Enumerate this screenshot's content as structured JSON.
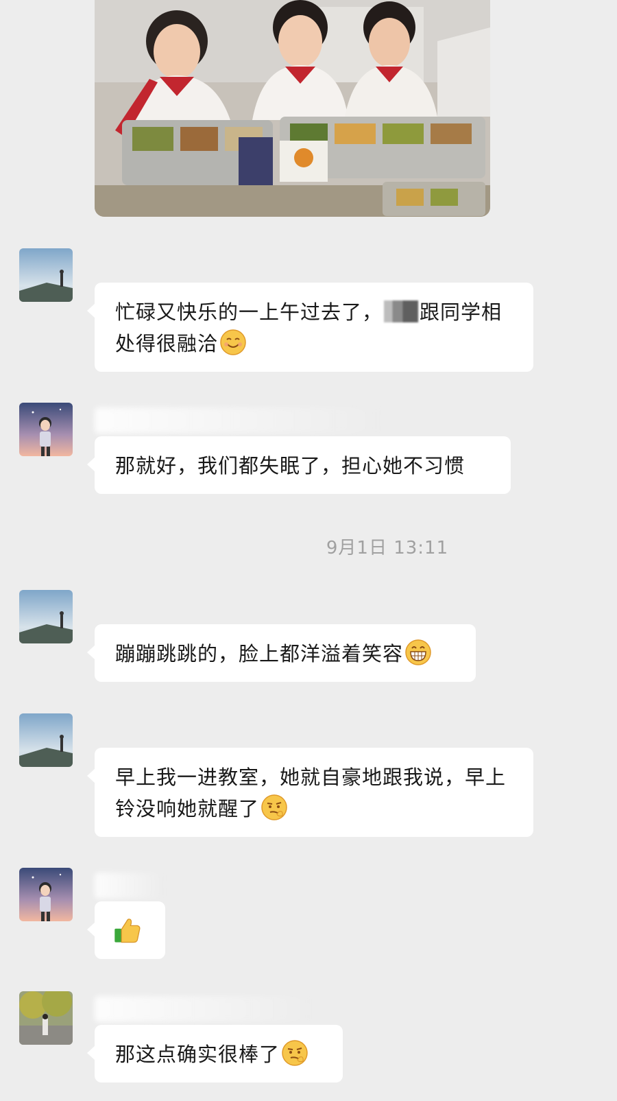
{
  "messages": [
    {
      "id": "m1",
      "text_a": "忙碌又快乐的一上午过去了，",
      "text_b": "跟同学相处得很融洽",
      "emoji": "smile-emoji-icon"
    },
    {
      "id": "m2",
      "text": "那就好，我们都失眠了，担心她不习惯"
    },
    {
      "id": "m3",
      "text": "蹦蹦跳跳的，脸上都洋溢着笑容",
      "emoji": "grin-emoji-icon"
    },
    {
      "id": "m4",
      "text": "早上我一进教室，她就自豪地跟我说，早上铃没响她就醒了",
      "emoji": "smirk-emoji-icon"
    },
    {
      "id": "m5",
      "text": "",
      "emoji": "thumbs-up-icon"
    },
    {
      "id": "m6",
      "text": "那这点确实很棒了",
      "emoji": "smirk-emoji-icon"
    }
  ],
  "timestamp": "9月1日 13:11",
  "colors": {
    "background": "#ededed",
    "bubble": "#ffffff",
    "timestamp": "#a0a0a0"
  }
}
